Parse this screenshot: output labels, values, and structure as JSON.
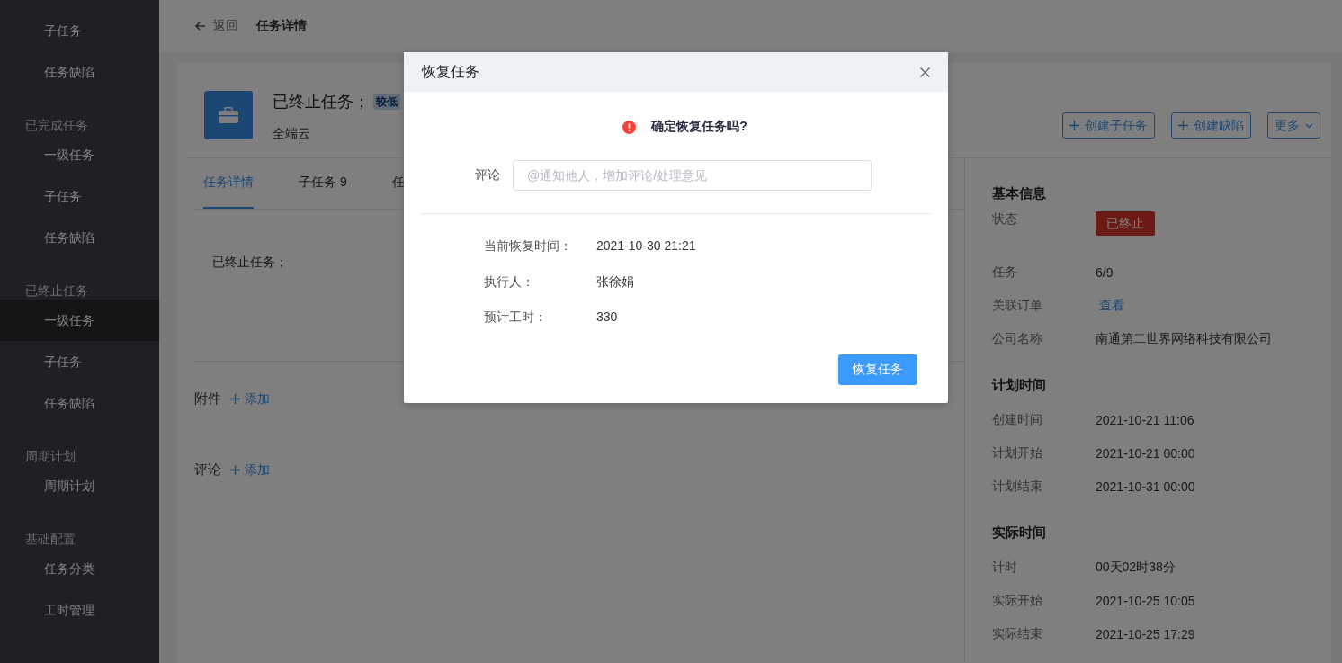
{
  "sidebar": {
    "sections": [
      {
        "items": [
          {
            "label": "子任务",
            "selected": false
          },
          {
            "label": "任务缺陷",
            "selected": false
          }
        ]
      },
      {
        "title": "已完成任务",
        "items": [
          {
            "label": "一级任务",
            "selected": false
          },
          {
            "label": "子任务",
            "selected": false
          },
          {
            "label": "任务缺陷",
            "selected": false
          }
        ]
      },
      {
        "title": "已终止任务",
        "items": [
          {
            "label": "一级任务",
            "selected": true
          },
          {
            "label": "子任务",
            "selected": false
          },
          {
            "label": "任务缺陷",
            "selected": false
          }
        ]
      },
      {
        "title": "周期计划",
        "items": [
          {
            "label": "周期计划",
            "selected": false
          }
        ]
      },
      {
        "title": "基础配置",
        "items": [
          {
            "label": "任务分类",
            "selected": false
          },
          {
            "label": "工时管理",
            "selected": false
          }
        ]
      }
    ]
  },
  "header": {
    "back_link": "返回",
    "page_title": "任务详情"
  },
  "task": {
    "title": "已终止任务；",
    "priority": "较低",
    "project": "全端云",
    "actions": [
      {
        "kind": "plus",
        "label": "创建子任务"
      },
      {
        "kind": "plus",
        "label": "创建缺陷"
      },
      {
        "kind": "dropdown",
        "label": "更多"
      }
    ],
    "tabs": [
      {
        "label": "任务详情",
        "selected": true
      },
      {
        "label": "子任务 9",
        "selected": false
      },
      {
        "label": "任",
        "selected": false
      }
    ],
    "description": "已终止任务；",
    "sections": [
      {
        "label": "附件",
        "action": "添加"
      },
      {
        "label": "评论",
        "action": "添加"
      }
    ]
  },
  "info_panel": {
    "groups": [
      {
        "title": "基本信息",
        "rows": [
          {
            "kind": "status",
            "label": "状态",
            "value": "已终止"
          },
          {
            "kind": "text",
            "label": "任务",
            "value": "6/9"
          },
          {
            "kind": "link",
            "label": "关联订单",
            "value": "查看"
          },
          {
            "kind": "text",
            "label": "公司名称",
            "value": "南通第二世界网络科技有限公司"
          }
        ]
      },
      {
        "title": "计划时间",
        "rows": [
          {
            "kind": "text",
            "label": "创建时间",
            "value": "2021-10-21 11:06"
          },
          {
            "kind": "text",
            "label": "计划开始",
            "value": "2021-10-21 00:00"
          },
          {
            "kind": "text",
            "label": "计划结束",
            "value": "2021-10-31 00:00"
          }
        ]
      },
      {
        "title": "实际时间",
        "rows": [
          {
            "kind": "text",
            "label": "计时",
            "value": "00天02时38分"
          },
          {
            "kind": "text",
            "label": "实际开始",
            "value": "2021-10-25 10:05"
          },
          {
            "kind": "text",
            "label": "实际结束",
            "value": "2021-10-25 17:29"
          }
        ]
      }
    ]
  },
  "dialog": {
    "title": "恢复任务",
    "prompt": "确定恢复任务吗?",
    "comment_label": "评论",
    "comment_placeholder": "@通知他人，增加评论/处理意见",
    "details": [
      {
        "label": "当前恢复时间：",
        "value": "2021-10-30 21:21"
      },
      {
        "label": "执行人：",
        "value": "张徐娟"
      },
      {
        "label": "预计工时：",
        "value": "330"
      }
    ],
    "confirm_button": "恢复任务"
  }
}
